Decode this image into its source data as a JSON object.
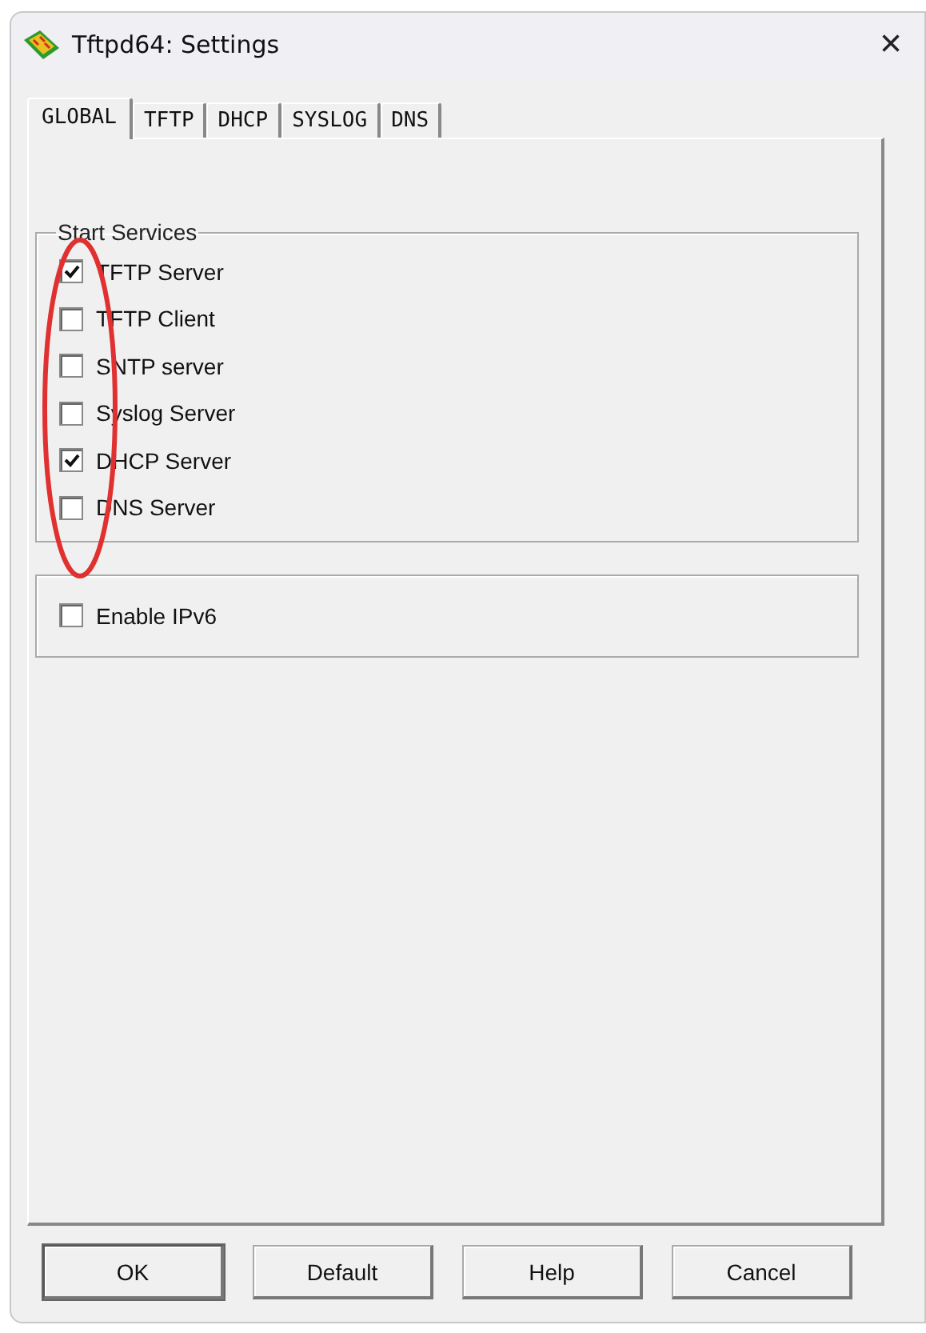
{
  "window": {
    "title": "Tftpd64: Settings",
    "close": "×"
  },
  "tabs": [
    {
      "label": "GLOBAL",
      "selected": true
    },
    {
      "label": "TFTP",
      "selected": false
    },
    {
      "label": "DHCP",
      "selected": false
    },
    {
      "label": "SYSLOG",
      "selected": false
    },
    {
      "label": "DNS",
      "selected": false
    }
  ],
  "start_services": {
    "title": "Start Services",
    "items": [
      {
        "label": "TFTP Server",
        "checked": true
      },
      {
        "label": "TFTP Client",
        "checked": false
      },
      {
        "label": "SNTP server",
        "checked": false
      },
      {
        "label": "Syslog Server",
        "checked": false
      },
      {
        "label": "DHCP Server",
        "checked": true
      },
      {
        "label": "DNS Server",
        "checked": false
      }
    ]
  },
  "ipv6": {
    "label": "Enable IPv6",
    "checked": false
  },
  "buttons": [
    {
      "label": "OK",
      "default": true
    },
    {
      "label": "Default",
      "default": false
    },
    {
      "label": "Help",
      "default": false
    },
    {
      "label": "Cancel",
      "default": false
    }
  ]
}
